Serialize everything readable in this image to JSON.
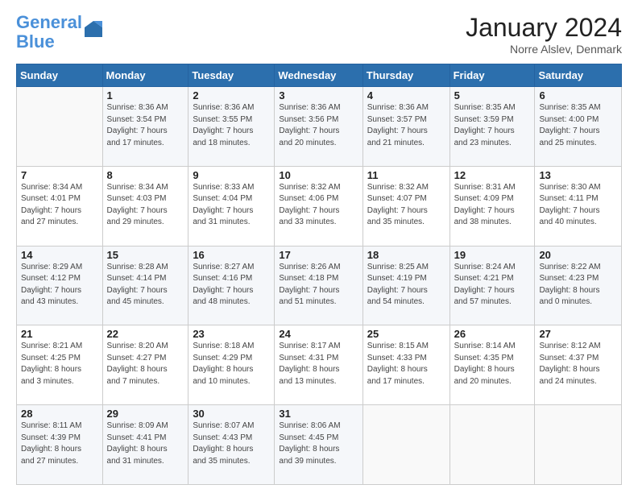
{
  "logo": {
    "line1": "General",
    "line2": "Blue"
  },
  "title": "January 2024",
  "subtitle": "Norre Alslev, Denmark",
  "days_of_week": [
    "Sunday",
    "Monday",
    "Tuesday",
    "Wednesday",
    "Thursday",
    "Friday",
    "Saturday"
  ],
  "weeks": [
    [
      {
        "day": "",
        "sunrise": "",
        "sunset": "",
        "daylight": ""
      },
      {
        "day": "1",
        "sunrise": "Sunrise: 8:36 AM",
        "sunset": "Sunset: 3:54 PM",
        "daylight": "Daylight: 7 hours and 17 minutes."
      },
      {
        "day": "2",
        "sunrise": "Sunrise: 8:36 AM",
        "sunset": "Sunset: 3:55 PM",
        "daylight": "Daylight: 7 hours and 18 minutes."
      },
      {
        "day": "3",
        "sunrise": "Sunrise: 8:36 AM",
        "sunset": "Sunset: 3:56 PM",
        "daylight": "Daylight: 7 hours and 20 minutes."
      },
      {
        "day": "4",
        "sunrise": "Sunrise: 8:36 AM",
        "sunset": "Sunset: 3:57 PM",
        "daylight": "Daylight: 7 hours and 21 minutes."
      },
      {
        "day": "5",
        "sunrise": "Sunrise: 8:35 AM",
        "sunset": "Sunset: 3:59 PM",
        "daylight": "Daylight: 7 hours and 23 minutes."
      },
      {
        "day": "6",
        "sunrise": "Sunrise: 8:35 AM",
        "sunset": "Sunset: 4:00 PM",
        "daylight": "Daylight: 7 hours and 25 minutes."
      }
    ],
    [
      {
        "day": "7",
        "sunrise": "Sunrise: 8:34 AM",
        "sunset": "Sunset: 4:01 PM",
        "daylight": "Daylight: 7 hours and 27 minutes."
      },
      {
        "day": "8",
        "sunrise": "Sunrise: 8:34 AM",
        "sunset": "Sunset: 4:03 PM",
        "daylight": "Daylight: 7 hours and 29 minutes."
      },
      {
        "day": "9",
        "sunrise": "Sunrise: 8:33 AM",
        "sunset": "Sunset: 4:04 PM",
        "daylight": "Daylight: 7 hours and 31 minutes."
      },
      {
        "day": "10",
        "sunrise": "Sunrise: 8:32 AM",
        "sunset": "Sunset: 4:06 PM",
        "daylight": "Daylight: 7 hours and 33 minutes."
      },
      {
        "day": "11",
        "sunrise": "Sunrise: 8:32 AM",
        "sunset": "Sunset: 4:07 PM",
        "daylight": "Daylight: 7 hours and 35 minutes."
      },
      {
        "day": "12",
        "sunrise": "Sunrise: 8:31 AM",
        "sunset": "Sunset: 4:09 PM",
        "daylight": "Daylight: 7 hours and 38 minutes."
      },
      {
        "day": "13",
        "sunrise": "Sunrise: 8:30 AM",
        "sunset": "Sunset: 4:11 PM",
        "daylight": "Daylight: 7 hours and 40 minutes."
      }
    ],
    [
      {
        "day": "14",
        "sunrise": "Sunrise: 8:29 AM",
        "sunset": "Sunset: 4:12 PM",
        "daylight": "Daylight: 7 hours and 43 minutes."
      },
      {
        "day": "15",
        "sunrise": "Sunrise: 8:28 AM",
        "sunset": "Sunset: 4:14 PM",
        "daylight": "Daylight: 7 hours and 45 minutes."
      },
      {
        "day": "16",
        "sunrise": "Sunrise: 8:27 AM",
        "sunset": "Sunset: 4:16 PM",
        "daylight": "Daylight: 7 hours and 48 minutes."
      },
      {
        "day": "17",
        "sunrise": "Sunrise: 8:26 AM",
        "sunset": "Sunset: 4:18 PM",
        "daylight": "Daylight: 7 hours and 51 minutes."
      },
      {
        "day": "18",
        "sunrise": "Sunrise: 8:25 AM",
        "sunset": "Sunset: 4:19 PM",
        "daylight": "Daylight: 7 hours and 54 minutes."
      },
      {
        "day": "19",
        "sunrise": "Sunrise: 8:24 AM",
        "sunset": "Sunset: 4:21 PM",
        "daylight": "Daylight: 7 hours and 57 minutes."
      },
      {
        "day": "20",
        "sunrise": "Sunrise: 8:22 AM",
        "sunset": "Sunset: 4:23 PM",
        "daylight": "Daylight: 8 hours and 0 minutes."
      }
    ],
    [
      {
        "day": "21",
        "sunrise": "Sunrise: 8:21 AM",
        "sunset": "Sunset: 4:25 PM",
        "daylight": "Daylight: 8 hours and 3 minutes."
      },
      {
        "day": "22",
        "sunrise": "Sunrise: 8:20 AM",
        "sunset": "Sunset: 4:27 PM",
        "daylight": "Daylight: 8 hours and 7 minutes."
      },
      {
        "day": "23",
        "sunrise": "Sunrise: 8:18 AM",
        "sunset": "Sunset: 4:29 PM",
        "daylight": "Daylight: 8 hours and 10 minutes."
      },
      {
        "day": "24",
        "sunrise": "Sunrise: 8:17 AM",
        "sunset": "Sunset: 4:31 PM",
        "daylight": "Daylight: 8 hours and 13 minutes."
      },
      {
        "day": "25",
        "sunrise": "Sunrise: 8:15 AM",
        "sunset": "Sunset: 4:33 PM",
        "daylight": "Daylight: 8 hours and 17 minutes."
      },
      {
        "day": "26",
        "sunrise": "Sunrise: 8:14 AM",
        "sunset": "Sunset: 4:35 PM",
        "daylight": "Daylight: 8 hours and 20 minutes."
      },
      {
        "day": "27",
        "sunrise": "Sunrise: 8:12 AM",
        "sunset": "Sunset: 4:37 PM",
        "daylight": "Daylight: 8 hours and 24 minutes."
      }
    ],
    [
      {
        "day": "28",
        "sunrise": "Sunrise: 8:11 AM",
        "sunset": "Sunset: 4:39 PM",
        "daylight": "Daylight: 8 hours and 27 minutes."
      },
      {
        "day": "29",
        "sunrise": "Sunrise: 8:09 AM",
        "sunset": "Sunset: 4:41 PM",
        "daylight": "Daylight: 8 hours and 31 minutes."
      },
      {
        "day": "30",
        "sunrise": "Sunrise: 8:07 AM",
        "sunset": "Sunset: 4:43 PM",
        "daylight": "Daylight: 8 hours and 35 minutes."
      },
      {
        "day": "31",
        "sunrise": "Sunrise: 8:06 AM",
        "sunset": "Sunset: 4:45 PM",
        "daylight": "Daylight: 8 hours and 39 minutes."
      },
      {
        "day": "",
        "sunrise": "",
        "sunset": "",
        "daylight": ""
      },
      {
        "day": "",
        "sunrise": "",
        "sunset": "",
        "daylight": ""
      },
      {
        "day": "",
        "sunrise": "",
        "sunset": "",
        "daylight": ""
      }
    ]
  ]
}
